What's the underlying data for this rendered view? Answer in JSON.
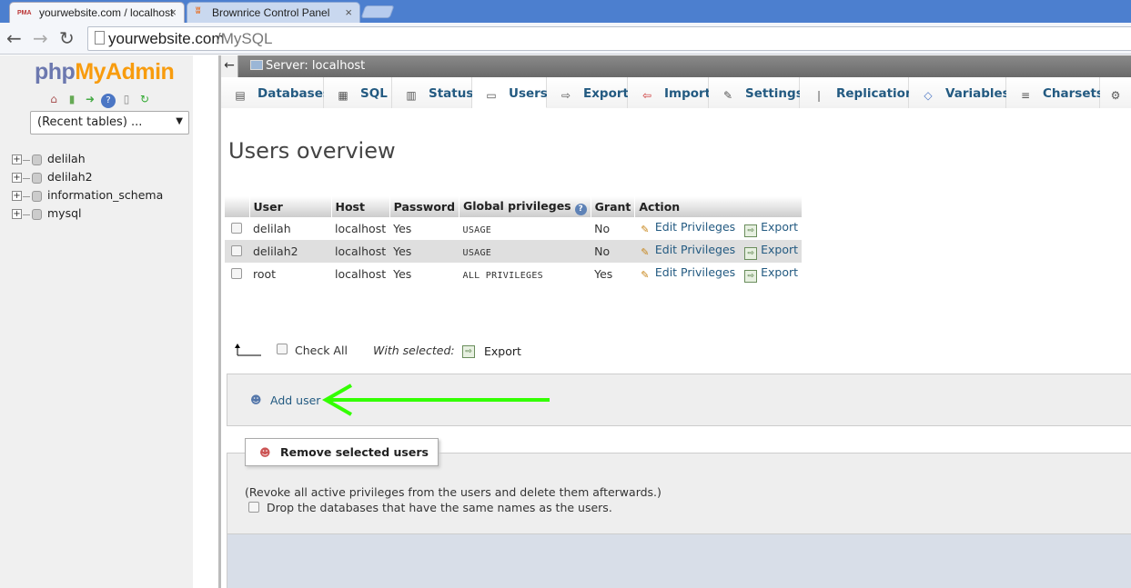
{
  "browser": {
    "tabs": [
      {
        "title": "yourwebsite.com / localhost",
        "favicon": "PMA"
      },
      {
        "title": "Brownrice Control Panel",
        "favicon": "brownrice-icon"
      }
    ],
    "url_host": "yourwebsite.com",
    "url_path": "/MySQL",
    "close_glyph": "×"
  },
  "sidebar": {
    "logo_php": "php",
    "logo_myadmin": "MyAdmin",
    "recent_tables": "(Recent tables) ...",
    "databases": [
      "delilah",
      "delilah2",
      "information_schema",
      "mysql"
    ]
  },
  "server": {
    "label": "Server: localhost"
  },
  "menu": {
    "tabs": [
      {
        "label": "Databases",
        "icon": "databases-icon"
      },
      {
        "label": "SQL",
        "icon": "sql-icon"
      },
      {
        "label": "Status",
        "icon": "status-icon"
      },
      {
        "label": "Users",
        "icon": "users-icon"
      },
      {
        "label": "Export",
        "icon": "export-icon"
      },
      {
        "label": "Import",
        "icon": "import-icon"
      },
      {
        "label": "Settings",
        "icon": "settings-icon"
      },
      {
        "label": "Replication",
        "icon": "replication-icon"
      },
      {
        "label": "Variables",
        "icon": "variables-icon"
      },
      {
        "label": "Charsets",
        "icon": "charsets-icon"
      }
    ],
    "active": "Users"
  },
  "page": {
    "title": "Users overview"
  },
  "users_table": {
    "headers": [
      "User",
      "Host",
      "Password",
      "Global privileges",
      "Grant",
      "Action"
    ],
    "rows": [
      {
        "user": "delilah",
        "host": "localhost",
        "password": "Yes",
        "privileges": "USAGE",
        "grant": "No"
      },
      {
        "user": "delilah2",
        "host": "localhost",
        "password": "Yes",
        "privileges": "USAGE",
        "grant": "No"
      },
      {
        "user": "root",
        "host": "localhost",
        "password": "Yes",
        "privileges": "ALL PRIVILEGES",
        "grant": "Yes"
      }
    ],
    "edit_label": "Edit Privileges",
    "export_label": "Export"
  },
  "bulk": {
    "check_all": "Check All",
    "with_selected": "With selected:",
    "export": "Export"
  },
  "add_user": {
    "label": "Add user"
  },
  "remove": {
    "legend": "Remove selected users",
    "note": "(Revoke all active privileges from the users and delete them afterwards.)",
    "drop_label": "Drop the databases that have the same names as the users."
  },
  "colors": {
    "link": "#235a81",
    "annotation_arrow": "#33ff00",
    "logo_php": "#6c78af",
    "logo_myadmin": "#f89c0e"
  }
}
